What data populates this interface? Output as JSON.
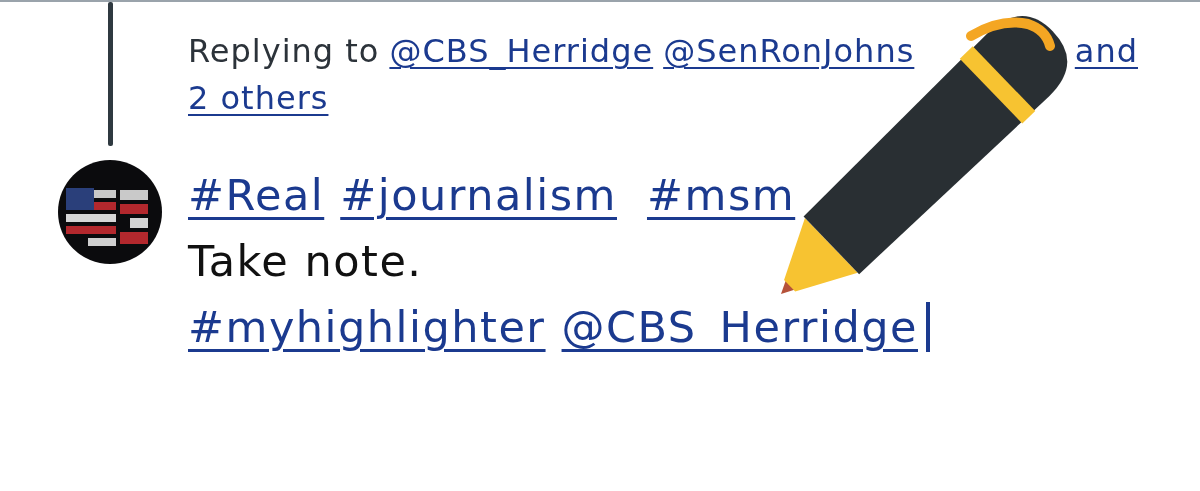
{
  "reply_context": {
    "label": "Replying to",
    "mentions": [
      "@CBS_Herridge",
      "@SenRonJohns"
    ],
    "others_link": [
      "and",
      "2 others"
    ]
  },
  "tweet": {
    "lines": [
      {
        "kind": "links",
        "parts": [
          "#Real",
          "#journalism",
          "#msm"
        ]
      },
      {
        "kind": "text",
        "text": "Take note."
      },
      {
        "kind": "links",
        "parts": [
          "#myhighlighter",
          "@CBS_Herridge"
        ]
      }
    ],
    "caret_visible": true
  }
}
